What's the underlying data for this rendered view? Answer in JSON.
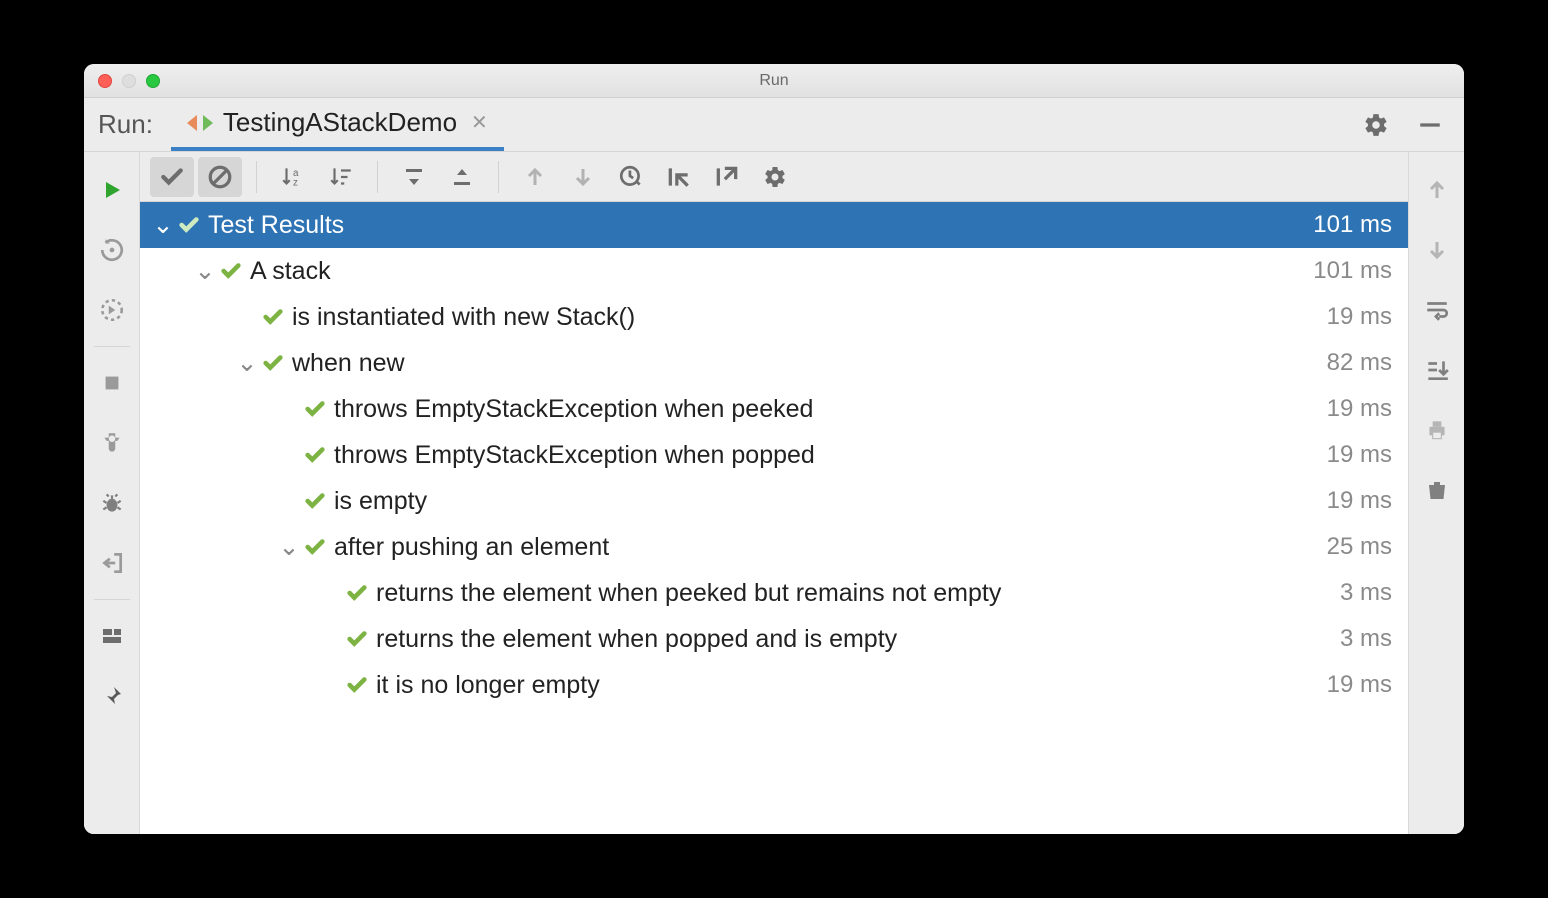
{
  "window": {
    "title": "Run"
  },
  "tabbar": {
    "run_label": "Run:",
    "tab_name": "TestingAStackDemo"
  },
  "tree": {
    "root": {
      "label": "Test Results",
      "time": "101 ms"
    },
    "n1": {
      "label": "A stack",
      "time": "101 ms"
    },
    "n1_1": {
      "label": "is instantiated with new Stack()",
      "time": "19 ms"
    },
    "n1_2": {
      "label": "when new",
      "time": "82 ms"
    },
    "n1_2_1": {
      "label": "throws EmptyStackException when peeked",
      "time": "19 ms"
    },
    "n1_2_2": {
      "label": "throws EmptyStackException when popped",
      "time": "19 ms"
    },
    "n1_2_3": {
      "label": "is empty",
      "time": "19 ms"
    },
    "n1_3": {
      "label": "after pushing an element",
      "time": "25 ms"
    },
    "n1_3_1": {
      "label": "returns the element when peeked but remains not empty",
      "time": "3 ms"
    },
    "n1_3_2": {
      "label": "returns the element when popped and is empty",
      "time": "3 ms"
    },
    "n1_3_3": {
      "label": "it is no longer empty",
      "time": "19 ms"
    }
  }
}
